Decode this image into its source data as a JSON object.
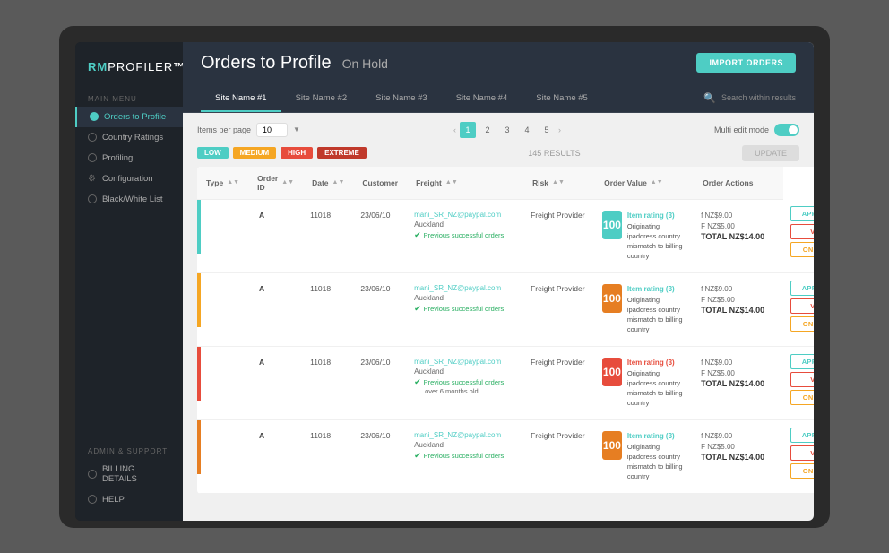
{
  "app": {
    "logo_rm": "RM",
    "logo_profiler": "PROFILER",
    "sidebar": {
      "section_main": "Main Menu",
      "section_admin": "Admin & Support",
      "items": [
        {
          "id": "orders-to-profile",
          "label": "Orders to Profile",
          "active": true
        },
        {
          "id": "country-ratings",
          "label": "Country Ratings"
        },
        {
          "id": "profiling",
          "label": "Profiling"
        },
        {
          "id": "configuration",
          "label": "Configuration"
        },
        {
          "id": "black-white-list",
          "label": "Black/White List"
        }
      ],
      "admin_items": [
        {
          "id": "billing-details",
          "label": "BILLING DETAILS"
        },
        {
          "id": "help",
          "label": "HELP"
        }
      ]
    }
  },
  "header": {
    "title": "Orders to Profile",
    "status": "On Hold",
    "import_button": "IMPORT ORDERS",
    "search_placeholder": "Search within results"
  },
  "tabs": [
    {
      "id": "site1",
      "label": "Site Name #1",
      "active": true
    },
    {
      "id": "site2",
      "label": "Site Name #2"
    },
    {
      "id": "site3",
      "label": "Site Name #3"
    },
    {
      "id": "site4",
      "label": "Site Name #4"
    },
    {
      "id": "site5",
      "label": "Site Name #5"
    }
  ],
  "toolbar": {
    "items_per_page_label": "Items per page",
    "items_per_page_value": "10",
    "multi_edit_label": "Multi edit mode",
    "update_button": "UPDATE",
    "results_count": "145 RESULTS",
    "pagination": [
      "1",
      "2",
      "3",
      "4",
      "5"
    ]
  },
  "filters": {
    "low": "LOW",
    "medium": "MEDIUM",
    "high": "HIGH",
    "extreme": "EXTREME"
  },
  "table": {
    "columns": [
      {
        "id": "type",
        "label": "Type"
      },
      {
        "id": "order_id",
        "label": "Order ID"
      },
      {
        "id": "date",
        "label": "Date"
      },
      {
        "id": "customer",
        "label": "Customer"
      },
      {
        "id": "freight",
        "label": "Freight"
      },
      {
        "id": "risk",
        "label": "Risk"
      },
      {
        "id": "order_value",
        "label": "Order Value"
      },
      {
        "id": "order_actions",
        "label": "Order Actions"
      }
    ],
    "rows": [
      {
        "indicator_color": "green",
        "type": "A",
        "order_id": "11018",
        "date": "23/06/10",
        "customer_email": "mani_SR_NZ@paypal.com",
        "customer_city": "Auckland",
        "customer_note": "Previous successful orders",
        "freight": "Freight Provider",
        "risk_score": "100",
        "risk_color": "teal",
        "risk_label": "Item rating (3)",
        "risk_label_color": "teal",
        "risk_text1": "Originating ipaddress country",
        "risk_text2": "mismatch to billing country",
        "value1": "f NZ$9.00",
        "value2": "F NZ$5.00",
        "total": "TOTAL NZ$14.00",
        "actions": [
          "APPROVE",
          "VOID",
          "ON HOLD"
        ],
        "note_extra": null
      },
      {
        "indicator_color": "yellow",
        "type": "A",
        "order_id": "11018",
        "date": "23/06/10",
        "customer_email": "mani_SR_NZ@paypal.com",
        "customer_city": "Auckland",
        "customer_note": "Previous successful orders",
        "freight": "Freight Provider",
        "risk_score": "100",
        "risk_color": "orange",
        "risk_label": "Item rating (3)",
        "risk_label_color": "teal",
        "risk_text1": "Originating ipaddress country",
        "risk_text2": "mismatch to billing country",
        "value1": "f NZ$9.00",
        "value2": "F NZ$5.00",
        "total": "TOTAL NZ$14.00",
        "actions": [
          "APPROVE",
          "VOID",
          "ON HOLD"
        ],
        "note_extra": null
      },
      {
        "indicator_color": "red",
        "type": "A",
        "order_id": "11018",
        "date": "23/06/10",
        "customer_email": "mani_SR_NZ@paypal.com",
        "customer_city": "Auckland",
        "customer_note": "Previous successful orders",
        "freight": "Freight Provider",
        "risk_score": "100",
        "risk_color": "red",
        "risk_label": "Item rating (3)",
        "risk_label_color": "red",
        "risk_text1": "Originating ipaddress country",
        "risk_text2": "mismatch to billing country",
        "value1": "f NZ$9.00",
        "value2": "F NZ$5.00",
        "total": "TOTAL NZ$14.00",
        "actions": [
          "APPROVE",
          "VOID",
          "ON HOLD"
        ],
        "note_extra": "over 6 months old"
      },
      {
        "indicator_color": "orange",
        "type": "A",
        "order_id": "11018",
        "date": "23/06/10",
        "customer_email": "mani_SR_NZ@paypal.com",
        "customer_city": "Auckland",
        "customer_note": "Previous successful orders",
        "freight": "Freight Provider",
        "risk_score": "100",
        "risk_color": "orange",
        "risk_label": "Item rating (3)",
        "risk_label_color": "teal",
        "risk_text1": "Originating ipaddress country",
        "risk_text2": "mismatch to billing country",
        "value1": "f NZ$9.00",
        "value2": "F NZ$5.00",
        "total": "TOTAL NZ$14.00",
        "actions": [
          "APPROVE",
          "VOID",
          "ON HOLD"
        ],
        "note_extra": null
      }
    ]
  }
}
